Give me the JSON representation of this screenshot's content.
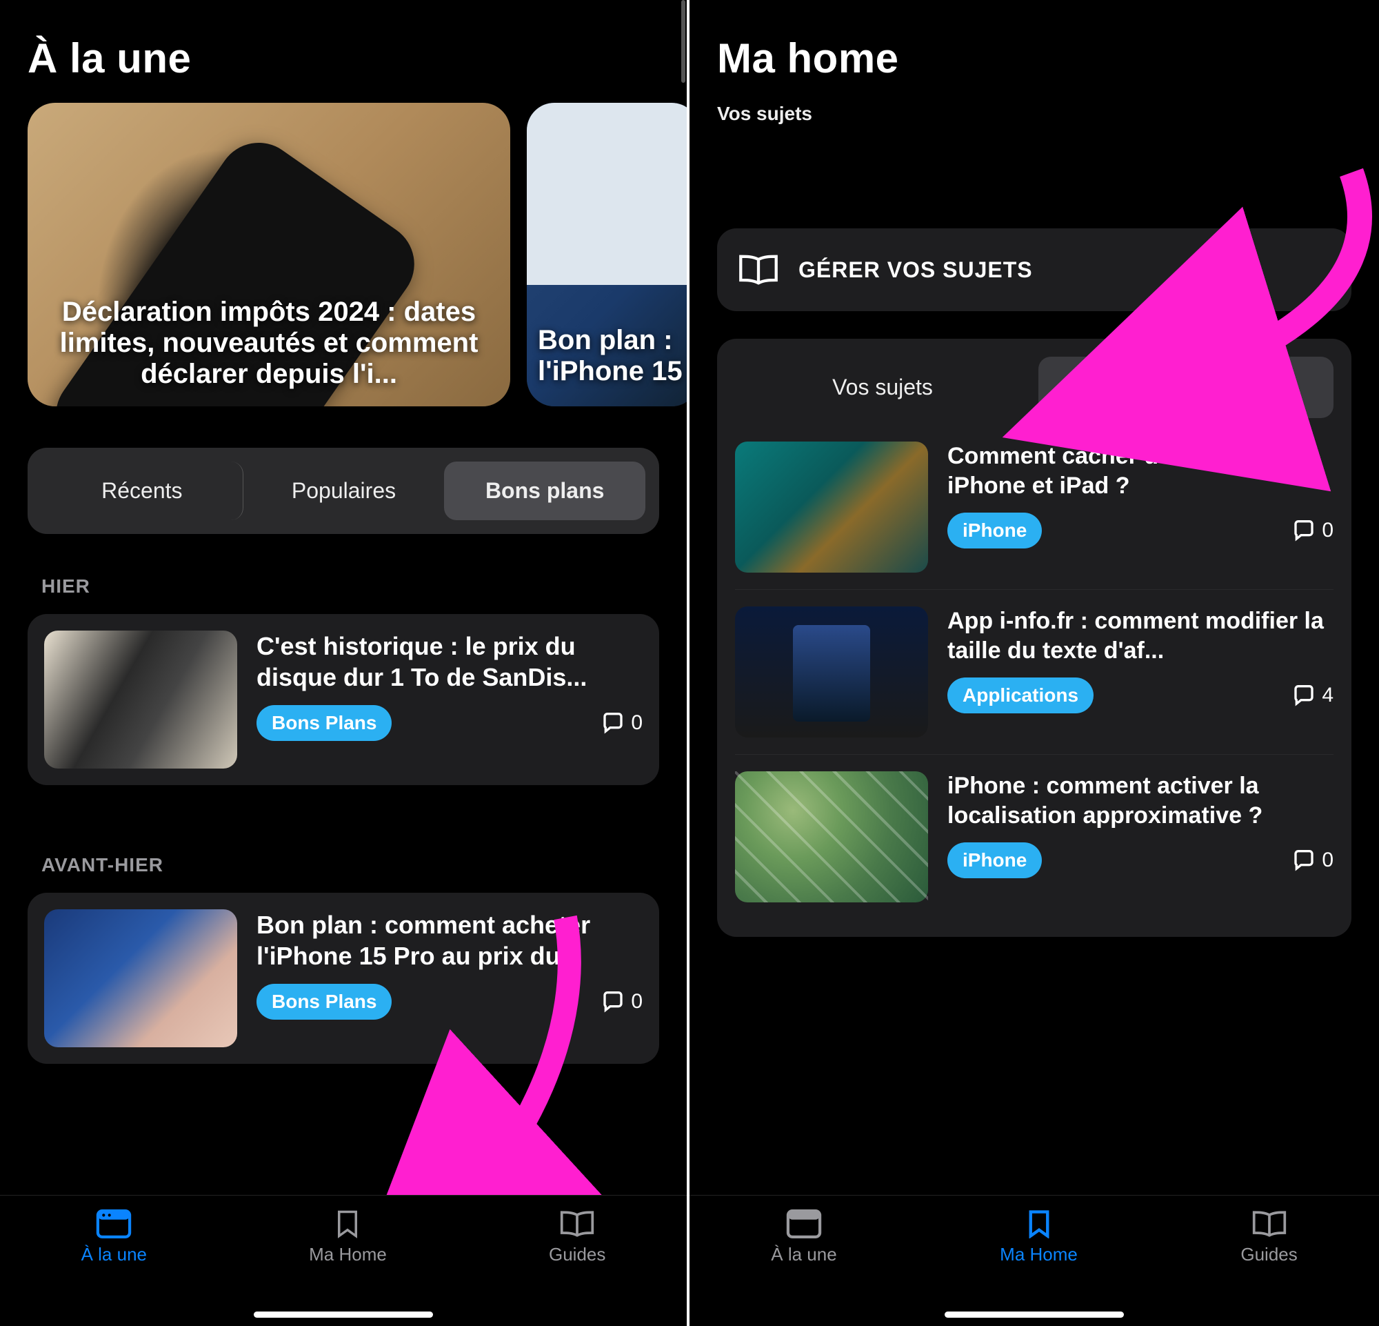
{
  "left": {
    "title": "À la une",
    "hero": [
      {
        "headline": "Déclaration impôts 2024 : dates limites, nouveautés et comment déclarer depuis l'i..."
      },
      {
        "headline": "Bon plan : l'iPhone 15"
      }
    ],
    "segments": {
      "a": "Récents",
      "b": "Populaires",
      "c": "Bons plans"
    },
    "sections": [
      {
        "label": "HIER",
        "article": {
          "title": "C'est historique : le prix du disque dur 1 To de SanDis...",
          "tag": "Bons Plans",
          "comments": "0"
        }
      },
      {
        "label": "AVANT-HIER",
        "article": {
          "title": "Bon plan : comment acheter l'iPhone 15 Pro au prix du...",
          "tag": "Bons Plans",
          "comments": "0"
        }
      }
    ],
    "tabs": {
      "a": "À la une",
      "b": "Ma Home",
      "c": "Guides"
    }
  },
  "right": {
    "title": "Ma home",
    "subhead": "Vos sujets",
    "manage_label": "GÉRER VOS SUJETS",
    "fav_segments": {
      "a": "Vos sujets",
      "b": "Vos favoris"
    },
    "favorites": [
      {
        "title": "Comment cacher des photos sur iPhone et iPad ?",
        "tag": "iPhone",
        "comments": "0"
      },
      {
        "title": "App i-nfo.fr : comment modifier la taille du texte d'af...",
        "tag": "Applications",
        "comments": "4"
      },
      {
        "title": "iPhone : comment activer la localisation approximative ?",
        "tag": "iPhone",
        "comments": "0"
      }
    ],
    "tabs": {
      "a": "À la une",
      "b": "Ma Home",
      "c": "Guides"
    }
  }
}
